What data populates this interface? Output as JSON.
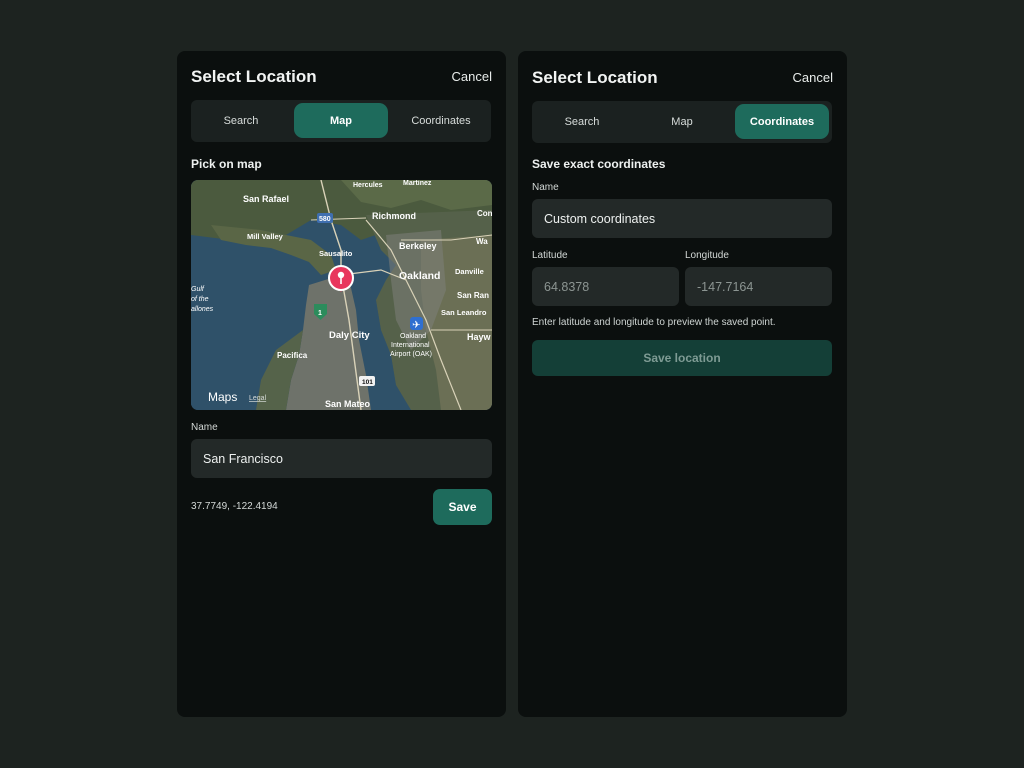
{
  "left": {
    "title": "Select Location",
    "cancel": "Cancel",
    "tabs": [
      "Search",
      "Map",
      "Coordinates"
    ],
    "active_tab": "Map",
    "section_title": "Pick on map",
    "map": {
      "places": [
        "Hercules",
        "Martinez",
        "San Rafael",
        "580",
        "Richmond",
        "Con",
        "Mill Valley",
        "Sausalito",
        "Berkeley",
        "Wa",
        "Oakland",
        "Danville",
        "Gulf",
        "of the",
        "allones",
        "San Ran",
        "San Leandro",
        "Oakland",
        "International",
        "Airport (OAK)",
        "Hayw",
        "Daly City",
        "Pacifica",
        "101",
        "San Mateo",
        "1"
      ],
      "brand": "Maps",
      "legal": "Legal"
    },
    "name_label": "Name",
    "name_value": "San Francisco",
    "coords": "37.7749, -122.4194",
    "save": "Save"
  },
  "right": {
    "title": "Select Location",
    "cancel": "Cancel",
    "tabs": [
      "Search",
      "Map",
      "Coordinates"
    ],
    "active_tab": "Coordinates",
    "section_title": "Save exact coordinates",
    "name_label": "Name",
    "name_value": "Custom coordinates",
    "latitude_label": "Latitude",
    "latitude_placeholder": "64.8378",
    "longitude_label": "Longitude",
    "longitude_placeholder": "-147.7164",
    "hint": "Enter latitude and longitude to preview the saved point.",
    "save_location": "Save location"
  },
  "colors": {
    "accent": "#1e6b5c",
    "pin": "#e8365d",
    "panel": "#0b0f0e",
    "background": "#1d2320"
  }
}
